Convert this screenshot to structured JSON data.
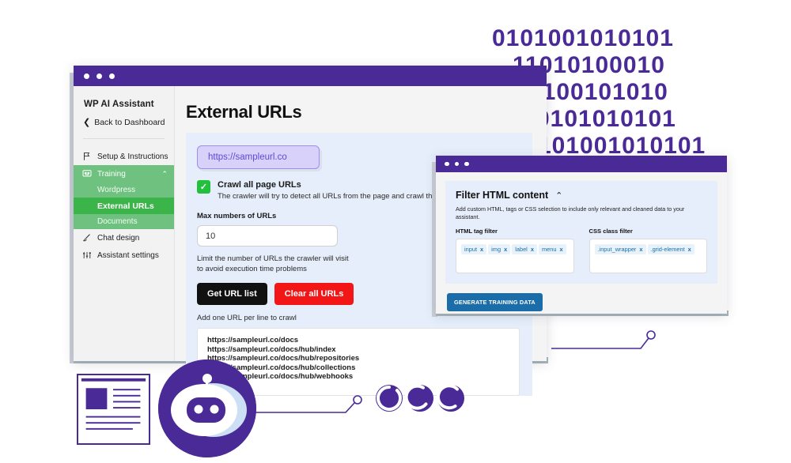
{
  "backdrop": {
    "binary_rows": [
      "0101001010101",
      "11010100010",
      "0100101010",
      "0101010101",
      "101001010101"
    ],
    "color": "#4a2a96"
  },
  "window_main": {
    "titlebar_dots": 3,
    "sidebar": {
      "brand": "WP AI Assistant",
      "back_link": "Back to Dashboard",
      "items": [
        {
          "label": "Setup & Instructions",
          "icon": "flag-icon",
          "state": "default"
        },
        {
          "label": "Training",
          "icon": "monitor-face-icon",
          "state": "group-open",
          "caret": "⌃"
        },
        {
          "label": "Wordpress",
          "icon": "",
          "state": "sub"
        },
        {
          "label": "External URLs",
          "icon": "",
          "state": "sub-active"
        },
        {
          "label": "Documents",
          "icon": "",
          "state": "sub"
        },
        {
          "label": "Chat design",
          "icon": "brush-icon",
          "state": "default"
        },
        {
          "label": "Assistant settings",
          "icon": "sliders-icon",
          "state": "default"
        }
      ]
    },
    "page_title": "External URLs",
    "url_pill": "https://sampleurl.co",
    "crawl_checkbox": {
      "checked": true,
      "check_glyph": "✓",
      "title": "Crawl all page URLs",
      "description": "The crawler will try to detect all URLs from the page and crawl them."
    },
    "max_urls": {
      "label": "Max numbers of URLs",
      "value": "10",
      "hint": "Limit the number of URLs the crawler will visit\nto avoid execution time problems"
    },
    "buttons": {
      "get_url_list": "Get URL list",
      "clear_all_urls": "Clear all URLs"
    },
    "url_list": {
      "hint": "Add one URL per line to crawl",
      "urls": [
        "https://sampleurl.co/docs",
        "https://sampleurl.co/docs/hub/index",
        "https://sampleurl.co/docs/hub/repositories",
        "https://sampleurl.co/docs/hub/collections",
        "https://sampleurl.co/docs/hub/webhooks"
      ]
    }
  },
  "window_filter": {
    "titlebar_dots": 3,
    "title": "Filter HTML content",
    "collapse_caret": "⌃",
    "description": "Add custom HTML, tags or CSS selection to include only relevant and cleaned data to your assistant.",
    "html_tag_filter": {
      "label": "HTML tag filter",
      "tags": [
        "input",
        "img",
        "label",
        "menu"
      ],
      "remove_glyph": "x"
    },
    "css_class_filter": {
      "label": "CSS class filter",
      "tags": [
        ".input_wrapper",
        ".grid-element"
      ],
      "remove_glyph": "x"
    },
    "generate_button": "GENERATE TRAINING DATA"
  },
  "decorations": {
    "robot_icon": "robot-avatar",
    "document_icon": "document-card",
    "loader_rings": 3
  },
  "colors": {
    "brand_purple": "#4a2a96",
    "accent_green": "#3bb44a",
    "nav_green": "#6ec17e",
    "card_blue": "#e5eefa",
    "pill_purple": "#d8d2fb",
    "pill_text": "#6147d6",
    "danger_red": "#f21616",
    "dark_button": "#111111",
    "generate_blue": "#1a6da8",
    "tag_blue": "#1b6fa8"
  }
}
